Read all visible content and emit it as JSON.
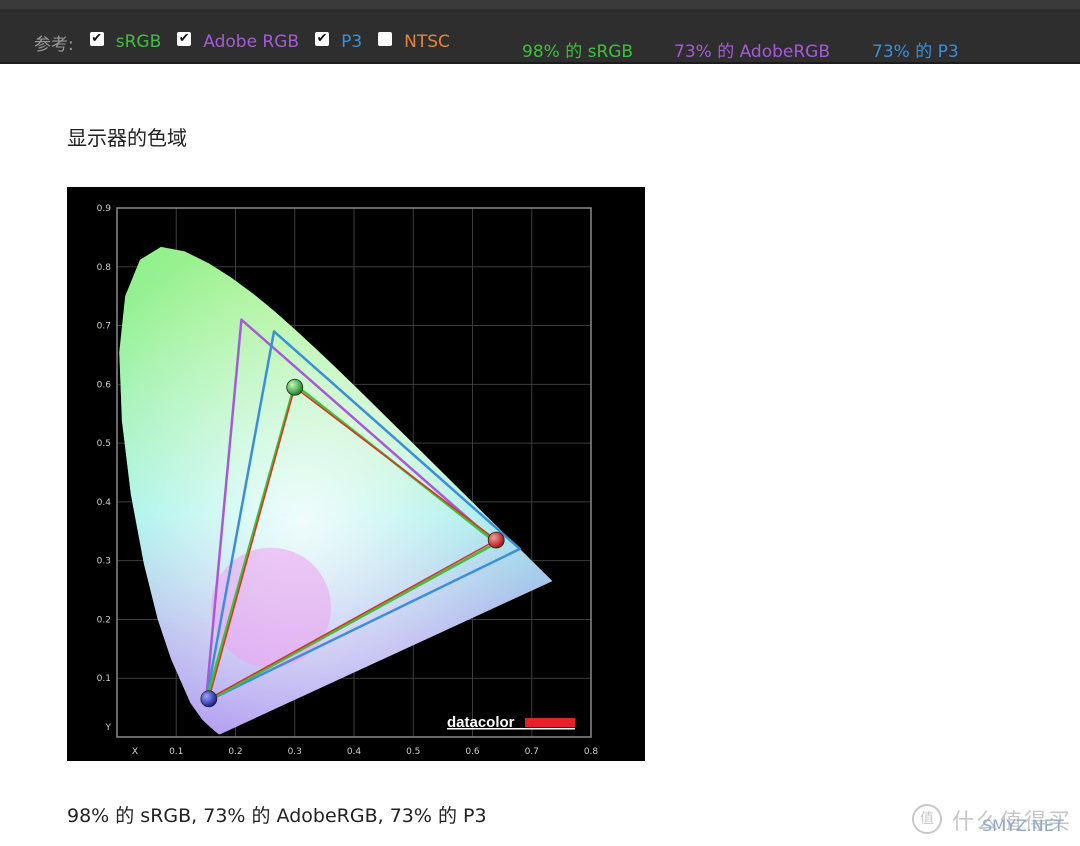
{
  "toolbar": {
    "ref_label": "参考:",
    "items": [
      {
        "label": "sRGB",
        "checked": true,
        "color": "#3ec03e",
        "check_glyph": "✔"
      },
      {
        "label": "Adobe RGB",
        "checked": true,
        "color": "#a65ad6",
        "check_glyph": "✔"
      },
      {
        "label": "P3",
        "checked": true,
        "color": "#3b8fd8",
        "check_glyph": "✔"
      },
      {
        "label": "NTSC",
        "checked": false,
        "color": "#e8843a",
        "check_glyph": ""
      }
    ],
    "results": [
      {
        "text": "98% 的 sRGB",
        "color": "#3ec03e"
      },
      {
        "text": "73% 的 AdobeRGB",
        "color": "#a65ad6"
      },
      {
        "text": "73% 的 P3",
        "color": "#3b8fd8"
      }
    ]
  },
  "heading": "显示器的色域",
  "chart_data": {
    "type": "scatter",
    "xlim": [
      0,
      0.8
    ],
    "ylim": [
      0,
      0.9
    ],
    "x_ticks": [
      "X",
      "0.1",
      "0.2",
      "0.3",
      "0.4",
      "0.5",
      "0.6",
      "0.7",
      "0.8"
    ],
    "y_ticks": [
      "Y",
      "0.1",
      "0.2",
      "0.3",
      "0.4",
      "0.5",
      "0.6",
      "0.7",
      "0.8",
      "0.9"
    ],
    "grid": true,
    "brand": "datacolor",
    "gamuts": [
      {
        "name": "Adobe RGB",
        "color": "#a65ad6",
        "points": [
          [
            0.64,
            0.33
          ],
          [
            0.21,
            0.71
          ],
          [
            0.15,
            0.06
          ]
        ]
      },
      {
        "name": "P3",
        "color": "#3b8fd8",
        "points": [
          [
            0.68,
            0.32
          ],
          [
            0.265,
            0.69
          ],
          [
            0.15,
            0.06
          ]
        ]
      },
      {
        "name": "sRGB",
        "color": "#3ec03e",
        "points": [
          [
            0.64,
            0.33
          ],
          [
            0.3,
            0.6
          ],
          [
            0.15,
            0.06
          ]
        ]
      },
      {
        "name": "Display",
        "color": "#e03020",
        "points": [
          [
            0.64,
            0.335
          ],
          [
            0.3,
            0.595
          ],
          [
            0.155,
            0.065
          ]
        ]
      }
    ],
    "primaries": [
      {
        "name": "red",
        "x": 0.64,
        "y": 0.335,
        "color": "#d42a2a"
      },
      {
        "name": "green",
        "x": 0.3,
        "y": 0.595,
        "color": "#3fbf3f"
      },
      {
        "name": "blue",
        "x": 0.155,
        "y": 0.065,
        "color": "#2a33c8"
      }
    ]
  },
  "caption": "98% 的 sRGB, 73% 的 AdobeRGB, 73% 的 P3",
  "watermark": {
    "logo": "值",
    "cn": "什么值得买",
    "en": "SMYZ.NET"
  }
}
